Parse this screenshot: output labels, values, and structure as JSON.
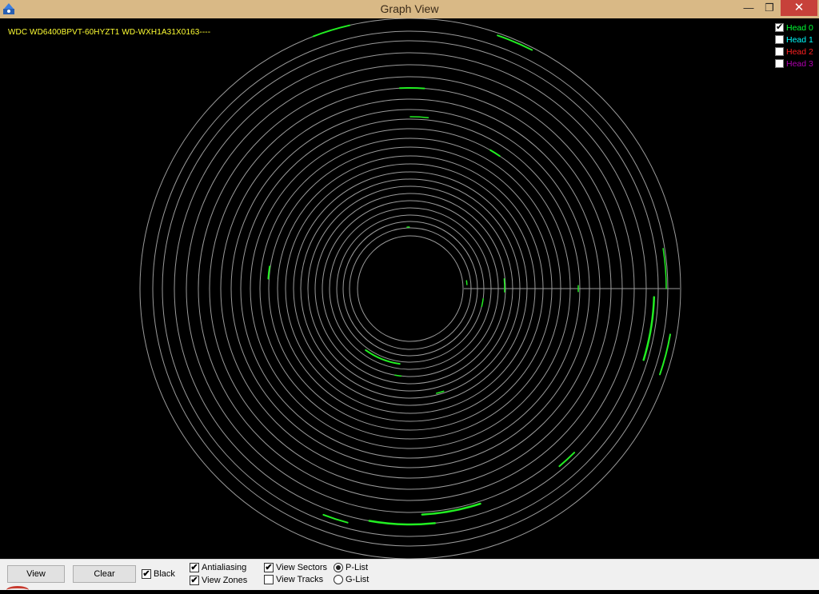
{
  "window": {
    "title": "Graph View",
    "minimize_glyph": "—",
    "maximize_glyph": "❐",
    "close_glyph": "✕"
  },
  "drive": {
    "label": "WDC WD6400BPVT-60HYZT1 WD-WXH1A31X0163----"
  },
  "heads": [
    {
      "label": "Head 0",
      "checked": true,
      "color": "#00ff33"
    },
    {
      "label": "Head 1",
      "checked": false,
      "color": "#00ffff"
    },
    {
      "label": "Head 2",
      "checked": false,
      "color": "#ff2020"
    },
    {
      "label": "Head 3",
      "checked": false,
      "color": "#b000b0"
    }
  ],
  "controls": {
    "view_button": "View",
    "clear_button": "Clear",
    "black": {
      "label": "Black",
      "checked": true
    },
    "antialiasing": {
      "label": "Antialiasing",
      "checked": true
    },
    "view_zones": {
      "label": "View Zones",
      "checked": true
    },
    "view_sectors": {
      "label": "View Sectors",
      "checked": true
    },
    "view_tracks": {
      "label": "View Tracks",
      "checked": false
    },
    "p_list": {
      "label": "P-List",
      "selected": true
    },
    "g_list": {
      "label": "G-List",
      "selected": false
    }
  },
  "colors": {
    "zone_ring": "#9a9a9a",
    "defect": "#22ee22",
    "drive_label": "#ffff33",
    "titlebar": "#d9b986"
  }
}
